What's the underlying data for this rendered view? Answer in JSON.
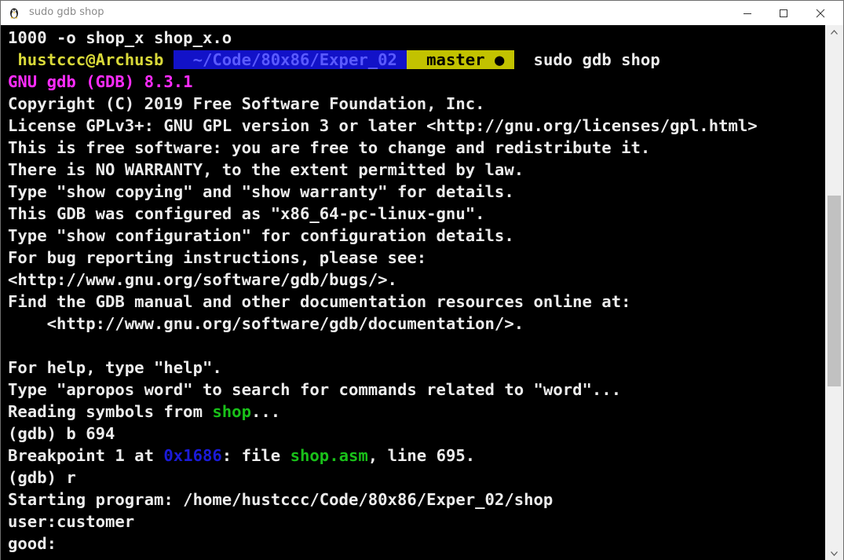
{
  "window": {
    "title": "sudo gdb shop",
    "app_icon": "terminal-penguin-icon",
    "controls": {
      "minimize": "minimize-icon",
      "maximize": "maximize-icon",
      "close": "close-icon"
    }
  },
  "colors": {
    "prompt_user_fg": "#d9d939",
    "prompt_dir_bg": "#1212c8",
    "prompt_git_bg": "#c2c200",
    "gdb_banner": "#ff2cff",
    "filename": "#19c019",
    "address": "#1b1bd8"
  },
  "terminal": {
    "line_0": "1000 -o shop_x shop_x.o",
    "prompt": {
      "user": " hustccc@Archusb ",
      "dir": "  ~/Code/80x86/Exper_02 ",
      "git": "  master ● ",
      "command": "  sudo gdb shop"
    },
    "banner": "GNU gdb (GDB) 8.3.1",
    "copyright": "Copyright (C) 2019 Free Software Foundation, Inc.",
    "license": "License GPLv3+: GNU GPL version 3 or later <http://gnu.org/licenses/gpl.html>",
    "free": "This is free software: you are free to change and redistribute it.",
    "warranty": "There is NO WARRANTY, to the extent permitted by law.",
    "type_show": "Type \"show copying\" and \"show warranty\" for details.",
    "configured": "This GDB was configured as \"x86_64-pc-linux-gnu\".",
    "type_config": "Type \"show configuration\" for configuration details.",
    "bug_reporting": "For bug reporting instructions, please see:",
    "bugs_url": "<http://www.gnu.org/software/gdb/bugs/>.",
    "find_manual": "Find the GDB manual and other documentation resources online at:",
    "doc_url": "    <http://www.gnu.org/software/gdb/documentation/>.",
    "help": "For help, type \"help\".",
    "apropos": "Type \"apropos word\" to search for commands related to \"word\"...",
    "reading": {
      "prefix": "Reading symbols from ",
      "file": "shop",
      "suffix": "..."
    },
    "cmd_break": "(gdb) b 694",
    "breakpoint": {
      "prefix": "Breakpoint 1 at ",
      "address": "0x1686",
      "mid": ": file ",
      "file": "shop.asm",
      "suffix": ", line 695."
    },
    "cmd_run": "(gdb) r",
    "starting": "Starting program: /home/hustccc/Code/80x86/Exper_02/shop",
    "user_line": "user:customer",
    "good_line": "good:"
  },
  "scrollbar": {
    "up": "scroll-up-arrow-icon",
    "down": "scroll-down-arrow-icon"
  }
}
